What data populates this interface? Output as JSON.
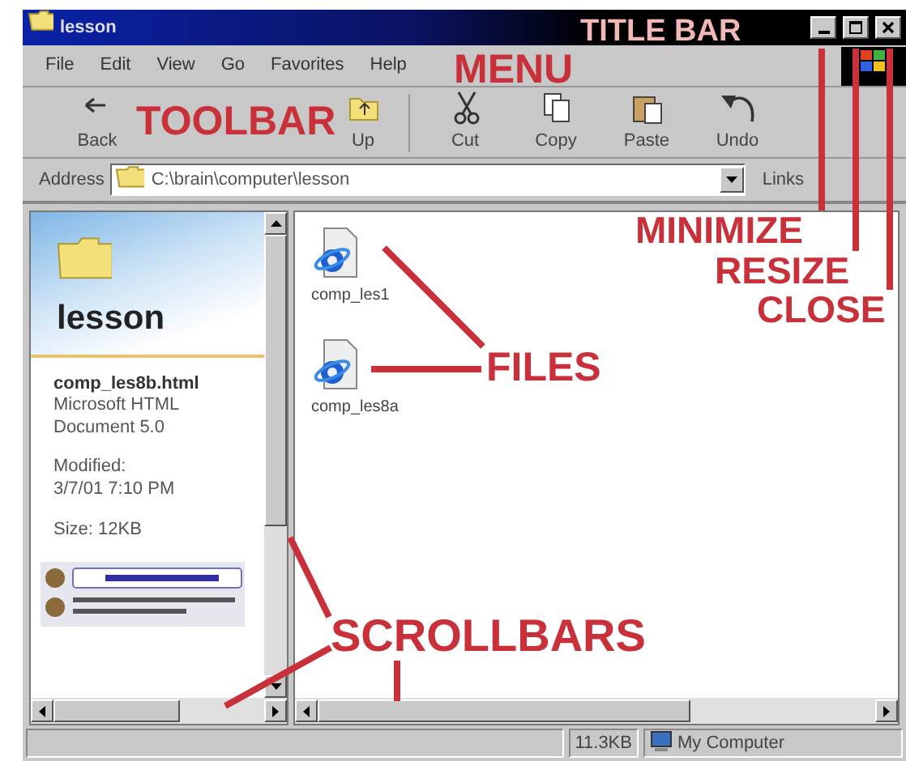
{
  "window": {
    "title": "lesson"
  },
  "menu": [
    "File",
    "Edit",
    "View",
    "Go",
    "Favorites",
    "Help"
  ],
  "toolbar": [
    {
      "label": "Back",
      "kind": "back"
    },
    {
      "label": "Up",
      "kind": "up"
    },
    {
      "label": "Cut",
      "kind": "cut"
    },
    {
      "label": "Copy",
      "kind": "copy"
    },
    {
      "label": "Paste",
      "kind": "paste"
    },
    {
      "label": "Undo",
      "kind": "undo"
    }
  ],
  "address": {
    "label": "Address",
    "value": "C:\\brain\\computer\\lesson",
    "links": "Links"
  },
  "info_panel": {
    "folder": "lesson",
    "file_name": "comp_les8b.html",
    "file_type": "Microsoft HTML Document 5.0",
    "modified_label": "Modified:",
    "modified": "3/7/01 7:10 PM",
    "size": "Size: 12KB"
  },
  "files": [
    {
      "name": "comp_les1"
    },
    {
      "name": "comp_les8a"
    }
  ],
  "status_bar": {
    "size": "11.3KB",
    "zone": "My Computer"
  },
  "annotations": [
    {
      "text": "TITLE BAR",
      "kind": "title"
    },
    {
      "text": "MENU",
      "kind": "menu"
    },
    {
      "text": "TOOLBAR",
      "kind": "toolbar"
    },
    {
      "text": "MINIMIZE",
      "kind": "minimize"
    },
    {
      "text": "RESIZE",
      "kind": "resize"
    },
    {
      "text": "CLOSE",
      "kind": "close"
    },
    {
      "text": "FILES",
      "kind": "files"
    },
    {
      "text": "SCROLLBARS",
      "kind": "scrollbars"
    }
  ]
}
